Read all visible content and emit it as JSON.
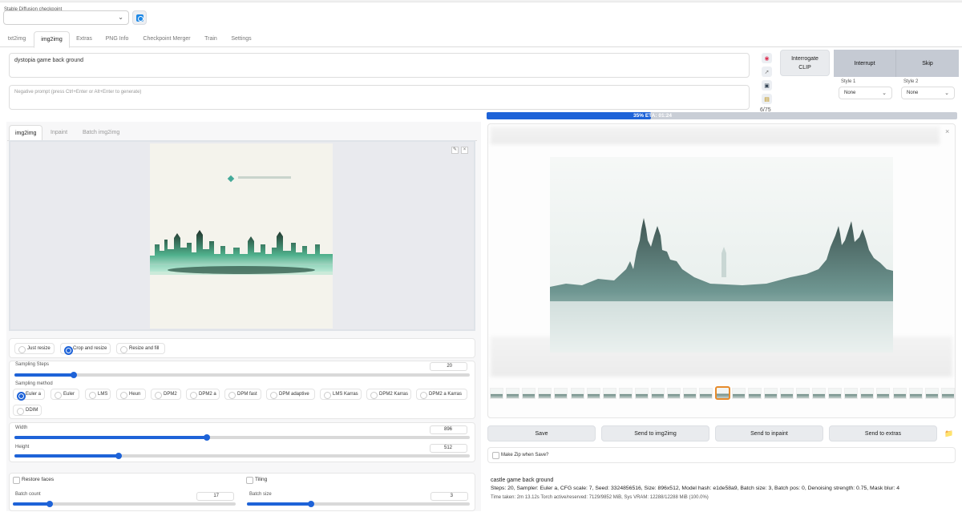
{
  "checkpoint": {
    "label": "Stable Diffusion checkpoint",
    "value": ""
  },
  "tabs": [
    "txt2img",
    "img2img",
    "Extras",
    "PNG Info",
    "Checkpoint Merger",
    "Train",
    "Settings"
  ],
  "prompt": {
    "value": "dystopia game back ground",
    "negative_placeholder": "Negative prompt (press Ctrl+Enter or Alt+Enter to generate)"
  },
  "token_counter": "6/75",
  "buttons": {
    "interrogate": "Interrogate\nCLIP",
    "interrupt": "Interrupt",
    "skip": "Skip"
  },
  "styles": {
    "style1_label": "Style 1",
    "style1_value": "None",
    "style2_label": "Style 2",
    "style2_value": "None"
  },
  "subtabs": [
    "img2img",
    "Inpaint",
    "Batch img2img"
  ],
  "resize_modes": {
    "options": [
      "Just resize",
      "Crop and resize",
      "Resize and fill"
    ],
    "selected": "Crop and resize"
  },
  "sampling_steps": {
    "label": "Sampling Steps",
    "value": "20",
    "fraction": 0.145
  },
  "sampling_method": {
    "label": "Sampling method",
    "options": [
      "Euler a",
      "Euler",
      "LMS",
      "Heun",
      "DPM2",
      "DPM2 a",
      "DPM fast",
      "DPM adaptive",
      "LMS Karras",
      "DPM2 Karras",
      "DPM2 a Karras",
      "DDIM"
    ],
    "selected": "Euler a"
  },
  "width": {
    "label": "Width",
    "value": "896",
    "fraction": 0.425
  },
  "height": {
    "label": "Height",
    "value": "512",
    "fraction": 0.23
  },
  "restore_faces": "Restore faces",
  "tiling": "Tiling",
  "batch_count": {
    "label": "Batch count",
    "value": "17",
    "fraction": 0.16
  },
  "batch_size": {
    "label": "Batch size",
    "value": "3",
    "fraction": 0.27
  },
  "progress": {
    "text": "35% ETA: 01:24",
    "percent": 35
  },
  "output_actions": [
    "Save",
    "Send to img2img",
    "Send to inpaint",
    "Send to extras"
  ],
  "make_zip": "Make Zip when Save?",
  "info": {
    "prompt": "castle game back ground",
    "params": "Steps: 20, Sampler: Euler a, CFG scale: 7, Seed: 3324856516, Size: 896x512, Model hash: e1de58a9, Batch size: 3, Batch pos: 0, Denoising strength: 0.75, Mask blur: 4",
    "time": "Time taken: 2m 13.12s  Torch active/reserved: 7129/9852 MiB, Sys VRAM: 12288/12288 MiB (100.0%)"
  },
  "thumbnail_count": 29,
  "selected_thumbnail": 14,
  "colors": {
    "accent": "#1e63d8",
    "selected_thumb": "#e68b2c",
    "button_dark": "#c5cad3"
  }
}
